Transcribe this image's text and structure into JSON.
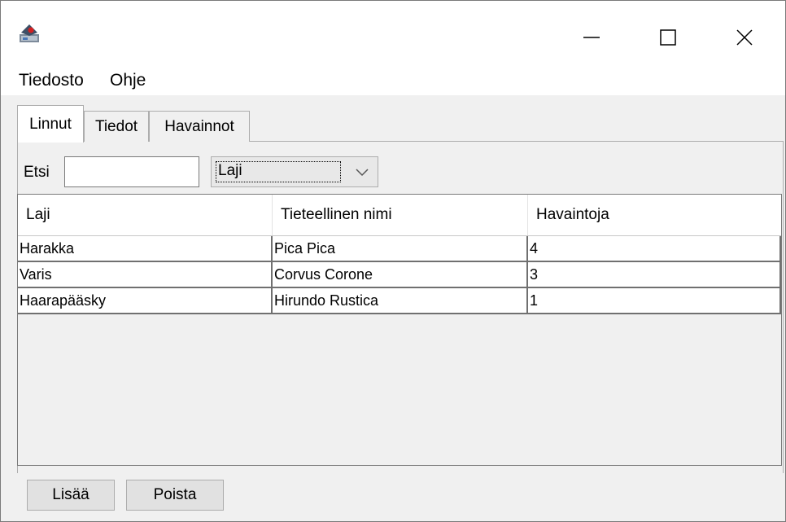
{
  "window": {
    "icon": "java-app-icon",
    "controls": {
      "minimize": "minimize-icon",
      "maximize": "maximize-icon",
      "close": "close-icon"
    }
  },
  "menubar": {
    "items": [
      {
        "label": "Tiedosto"
      },
      {
        "label": "Ohje"
      }
    ]
  },
  "tabs": [
    {
      "label": "Linnut",
      "selected": true
    },
    {
      "label": "Tiedot",
      "selected": false
    },
    {
      "label": "Havainnot",
      "selected": false
    }
  ],
  "search": {
    "label": "Etsi",
    "value": "",
    "field_selected": "Laji"
  },
  "table": {
    "columns": [
      "Laji",
      "Tieteellinen nimi",
      "Havaintoja"
    ],
    "rows": [
      [
        "Harakka",
        "Pica Pica",
        "4"
      ],
      [
        "Varis",
        "Corvus Corone",
        "3"
      ],
      [
        "Haarapääsky",
        "Hirundo Rustica",
        "1"
      ]
    ]
  },
  "buttons": {
    "add": "Lisää",
    "remove": "Poista"
  },
  "colors": {
    "window_bg": "#f0f0f0",
    "button_bg": "#e1e1e1",
    "border": "#adadad",
    "grid": "#707070"
  }
}
